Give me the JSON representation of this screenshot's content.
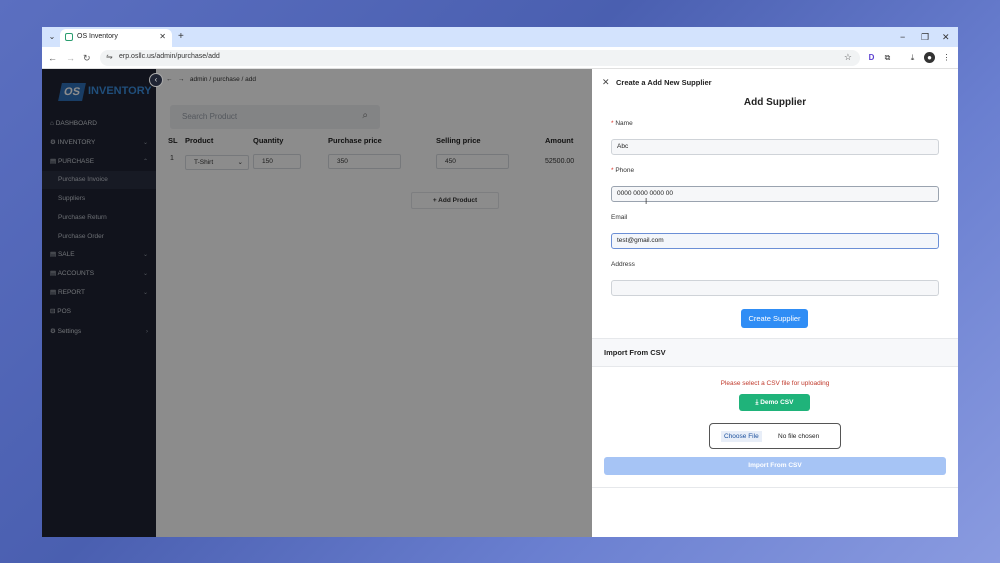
{
  "browser": {
    "tab_title": "OS Inventory",
    "url": "erp.osllc.us/admin/purchase/add"
  },
  "app": {
    "logo_mark": "OS",
    "logo_text": "INVENTORY",
    "breadcrumb": "admin  /  purchase  /  add"
  },
  "sidebar": {
    "items": [
      {
        "label": "⌂ DASHBOARD"
      },
      {
        "label": "⚙ INVENTORY"
      },
      {
        "label": "▤ PURCHASE"
      },
      {
        "label": "▤ SALE"
      },
      {
        "label": "▤ ACCOUNTS"
      },
      {
        "label": "▤ REPORT"
      },
      {
        "label": "⊟ POS"
      },
      {
        "label": "⚙ Settings"
      }
    ],
    "sub_items": [
      {
        "label": "Purchase Invoice"
      },
      {
        "label": "Suppliers"
      },
      {
        "label": "Purchase Return"
      },
      {
        "label": "Purchase Order"
      }
    ]
  },
  "purchase": {
    "search_placeholder": "Search Product",
    "headers": [
      "SL",
      "Product",
      "Quantity",
      "Purchase price",
      "Selling price",
      "Amount"
    ],
    "row": {
      "sl": "1",
      "product": "T-Shirt",
      "quantity": "150",
      "purchase_price": "350",
      "selling_price": "450",
      "amount": "52500.00"
    },
    "add_product": "+   Add Product"
  },
  "drawer": {
    "title": "Create a Add New Supplier",
    "form_title": "Add Supplier",
    "name_label": "Name",
    "name_value": "Abc",
    "phone_label": "Phone",
    "phone_value": "0000 0000 0000 00",
    "email_label": "Email",
    "email_value": "test@gmail.com",
    "address_label": "Address",
    "address_value": "",
    "create_button": "Create Supplier",
    "csv_title": "Import From CSV",
    "csv_message": "Please select a CSV file for uploading",
    "demo_csv": "⤓  Demo CSV",
    "choose_file": "Choose File",
    "no_file": "No file chosen",
    "import_button": "Import From CSV"
  },
  "colors": {
    "primary": "#2f8df5",
    "success": "#1fb37a",
    "sidebar_bg": "#1f2433",
    "error_text": "#c0392b"
  }
}
